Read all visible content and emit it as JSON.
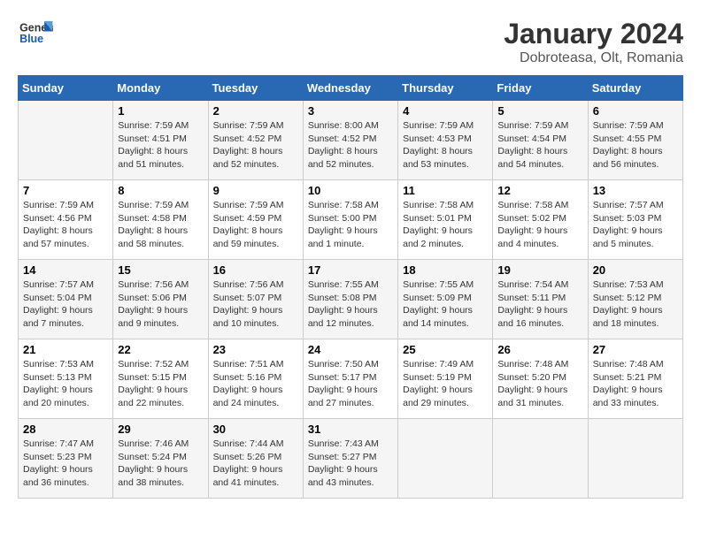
{
  "header": {
    "logo_line1": "General",
    "logo_line2": "Blue",
    "title": "January 2024",
    "subtitle": "Dobroteasa, Olt, Romania"
  },
  "days_of_week": [
    "Sunday",
    "Monday",
    "Tuesday",
    "Wednesday",
    "Thursday",
    "Friday",
    "Saturday"
  ],
  "weeks": [
    [
      {
        "day": "",
        "info": ""
      },
      {
        "day": "1",
        "info": "Sunrise: 7:59 AM\nSunset: 4:51 PM\nDaylight: 8 hours\nand 51 minutes."
      },
      {
        "day": "2",
        "info": "Sunrise: 7:59 AM\nSunset: 4:52 PM\nDaylight: 8 hours\nand 52 minutes."
      },
      {
        "day": "3",
        "info": "Sunrise: 8:00 AM\nSunset: 4:52 PM\nDaylight: 8 hours\nand 52 minutes."
      },
      {
        "day": "4",
        "info": "Sunrise: 7:59 AM\nSunset: 4:53 PM\nDaylight: 8 hours\nand 53 minutes."
      },
      {
        "day": "5",
        "info": "Sunrise: 7:59 AM\nSunset: 4:54 PM\nDaylight: 8 hours\nand 54 minutes."
      },
      {
        "day": "6",
        "info": "Sunrise: 7:59 AM\nSunset: 4:55 PM\nDaylight: 8 hours\nand 56 minutes."
      }
    ],
    [
      {
        "day": "7",
        "info": "Sunrise: 7:59 AM\nSunset: 4:56 PM\nDaylight: 8 hours\nand 57 minutes."
      },
      {
        "day": "8",
        "info": "Sunrise: 7:59 AM\nSunset: 4:58 PM\nDaylight: 8 hours\nand 58 minutes."
      },
      {
        "day": "9",
        "info": "Sunrise: 7:59 AM\nSunset: 4:59 PM\nDaylight: 8 hours\nand 59 minutes."
      },
      {
        "day": "10",
        "info": "Sunrise: 7:58 AM\nSunset: 5:00 PM\nDaylight: 9 hours\nand 1 minute."
      },
      {
        "day": "11",
        "info": "Sunrise: 7:58 AM\nSunset: 5:01 PM\nDaylight: 9 hours\nand 2 minutes."
      },
      {
        "day": "12",
        "info": "Sunrise: 7:58 AM\nSunset: 5:02 PM\nDaylight: 9 hours\nand 4 minutes."
      },
      {
        "day": "13",
        "info": "Sunrise: 7:57 AM\nSunset: 5:03 PM\nDaylight: 9 hours\nand 5 minutes."
      }
    ],
    [
      {
        "day": "14",
        "info": "Sunrise: 7:57 AM\nSunset: 5:04 PM\nDaylight: 9 hours\nand 7 minutes."
      },
      {
        "day": "15",
        "info": "Sunrise: 7:56 AM\nSunset: 5:06 PM\nDaylight: 9 hours\nand 9 minutes."
      },
      {
        "day": "16",
        "info": "Sunrise: 7:56 AM\nSunset: 5:07 PM\nDaylight: 9 hours\nand 10 minutes."
      },
      {
        "day": "17",
        "info": "Sunrise: 7:55 AM\nSunset: 5:08 PM\nDaylight: 9 hours\nand 12 minutes."
      },
      {
        "day": "18",
        "info": "Sunrise: 7:55 AM\nSunset: 5:09 PM\nDaylight: 9 hours\nand 14 minutes."
      },
      {
        "day": "19",
        "info": "Sunrise: 7:54 AM\nSunset: 5:11 PM\nDaylight: 9 hours\nand 16 minutes."
      },
      {
        "day": "20",
        "info": "Sunrise: 7:53 AM\nSunset: 5:12 PM\nDaylight: 9 hours\nand 18 minutes."
      }
    ],
    [
      {
        "day": "21",
        "info": "Sunrise: 7:53 AM\nSunset: 5:13 PM\nDaylight: 9 hours\nand 20 minutes."
      },
      {
        "day": "22",
        "info": "Sunrise: 7:52 AM\nSunset: 5:15 PM\nDaylight: 9 hours\nand 22 minutes."
      },
      {
        "day": "23",
        "info": "Sunrise: 7:51 AM\nSunset: 5:16 PM\nDaylight: 9 hours\nand 24 minutes."
      },
      {
        "day": "24",
        "info": "Sunrise: 7:50 AM\nSunset: 5:17 PM\nDaylight: 9 hours\nand 27 minutes."
      },
      {
        "day": "25",
        "info": "Sunrise: 7:49 AM\nSunset: 5:19 PM\nDaylight: 9 hours\nand 29 minutes."
      },
      {
        "day": "26",
        "info": "Sunrise: 7:48 AM\nSunset: 5:20 PM\nDaylight: 9 hours\nand 31 minutes."
      },
      {
        "day": "27",
        "info": "Sunrise: 7:48 AM\nSunset: 5:21 PM\nDaylight: 9 hours\nand 33 minutes."
      }
    ],
    [
      {
        "day": "28",
        "info": "Sunrise: 7:47 AM\nSunset: 5:23 PM\nDaylight: 9 hours\nand 36 minutes."
      },
      {
        "day": "29",
        "info": "Sunrise: 7:46 AM\nSunset: 5:24 PM\nDaylight: 9 hours\nand 38 minutes."
      },
      {
        "day": "30",
        "info": "Sunrise: 7:44 AM\nSunset: 5:26 PM\nDaylight: 9 hours\nand 41 minutes."
      },
      {
        "day": "31",
        "info": "Sunrise: 7:43 AM\nSunset: 5:27 PM\nDaylight: 9 hours\nand 43 minutes."
      },
      {
        "day": "",
        "info": ""
      },
      {
        "day": "",
        "info": ""
      },
      {
        "day": "",
        "info": ""
      }
    ]
  ]
}
